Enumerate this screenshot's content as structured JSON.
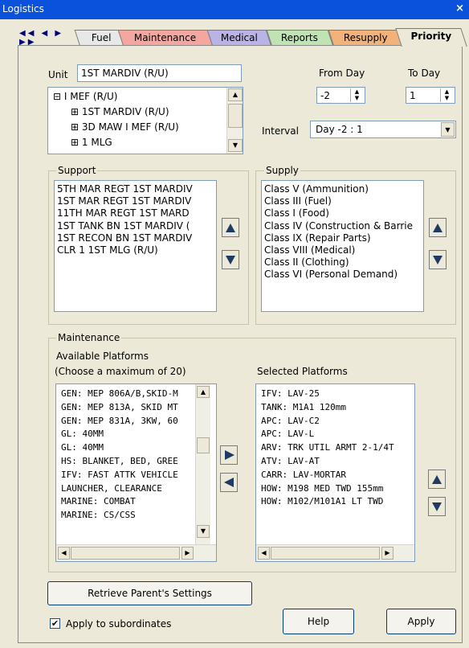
{
  "window": {
    "title": "Logistics",
    "close_glyph": "×"
  },
  "tabs": [
    {
      "label": "Fuel",
      "color": "#e8e8e8"
    },
    {
      "label": "Maintenance",
      "color": "#f4a6a0"
    },
    {
      "label": "Medical",
      "color": "#b9b3e6"
    },
    {
      "label": "Reports",
      "color": "#bfe3b3"
    },
    {
      "label": "Resupply",
      "color": "#f2b27a"
    },
    {
      "label": "Priority",
      "color": "#ece9d8"
    }
  ],
  "unit": {
    "label": "Unit",
    "value": "1ST MARDIV (R/U)",
    "tree": [
      {
        "sign": "⊟",
        "text": "I MEF (R/U)"
      },
      {
        "sign": "⊞",
        "text": "1ST MARDIV (R/U)"
      },
      {
        "sign": "⊞",
        "text": "3D MAW I MEF (R/U)"
      },
      {
        "sign": "⊞",
        "text": "1 MLG"
      }
    ]
  },
  "from_day": {
    "label": "From Day",
    "value": "-2"
  },
  "to_day": {
    "label": "To Day",
    "value": "1"
  },
  "interval": {
    "label": "Interval",
    "value": "Day -2 : 1"
  },
  "support": {
    "title": "Support",
    "items": [
      "5TH MAR REGT 1ST MARDIV",
      "1ST MAR REGT 1ST MARDIV",
      "11TH MAR REGT 1ST MARD",
      "1ST TANK BN 1ST MARDIV (",
      "1ST RECON BN 1ST MARDIV",
      "CLR 1 1ST MLG (R/U)"
    ]
  },
  "supply": {
    "title": "Supply",
    "items": [
      "Class V (Ammunition)",
      "Class III (Fuel)",
      "Class I (Food)",
      "Class IV (Construction & Barrie",
      "Class IX (Repair Parts)",
      "Class VIII (Medical)",
      "Class II (Clothing)",
      "Class VI (Personal Demand)"
    ]
  },
  "maintenance": {
    "title": "Maintenance",
    "available_label": "Available Platforms",
    "available_hint": "(Choose a maximum of 20)",
    "selected_label": "Selected Platforms",
    "available": [
      "GEN: MEP 806A/B,SKID-M",
      "GEN: MEP 813A, SKID MT",
      "GEN: MEP 831A, 3KW, 60",
      "GL: 40MM",
      "GL: 40MM",
      "HS: BLANKET, BED, GREE",
      "IFV: FAST ATTK VEHICLE",
      "LAUNCHER, CLEARANCE",
      "MARINE: COMBAT",
      "MARINE: CS/CSS"
    ],
    "selected": [
      "IFV: LAV-25",
      "TANK: M1A1 120mm",
      "APC: LAV-C2",
      "APC: LAV-L",
      "ARV: TRK UTIL ARMT 2-1/4T",
      "ATV: LAV-AT",
      "CARR: LAV-MORTAR",
      "HOW: M198 MED TWD 155mm",
      "HOW: M102/M101A1 LT TWD"
    ]
  },
  "retrieve_button": "Retrieve Parent's Settings",
  "apply_subordinates": {
    "label": "Apply to subordinates",
    "checked": true,
    "check_glyph": "✔"
  },
  "help_button": "Help",
  "apply_button": "Apply",
  "colors": {
    "title_bar": "#0a52dc",
    "arrow_button": "#1f3a63"
  }
}
